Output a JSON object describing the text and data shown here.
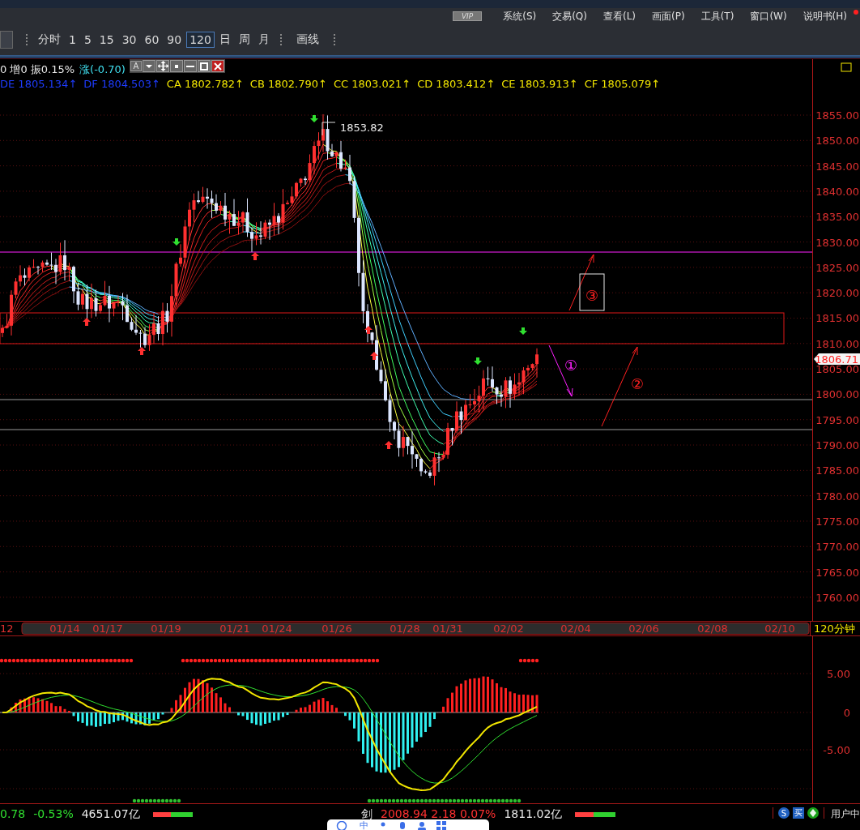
{
  "menu_bar": {
    "badge": "VIP",
    "items": [
      "系统(S)",
      "交易(Q)",
      "查看(L)",
      "画面(P)",
      "工具(T)",
      "窗口(W)",
      "说明书(H)"
    ]
  },
  "toolbar": {
    "periods": [
      {
        "label": "分时",
        "selected": false
      },
      {
        "label": "1",
        "selected": false
      },
      {
        "label": "5",
        "selected": false
      },
      {
        "label": "15",
        "selected": false
      },
      {
        "label": "30",
        "selected": false
      },
      {
        "label": "60",
        "selected": false
      },
      {
        "label": "90",
        "selected": false
      },
      {
        "label": "120",
        "selected": true
      },
      {
        "label": "日",
        "selected": false
      },
      {
        "label": "周",
        "selected": false
      },
      {
        "label": "月",
        "selected": false
      }
    ],
    "draw_label": "画线"
  },
  "quote_line": {
    "stats": "0 增0 振0.15%",
    "change": "涨(-0.70)"
  },
  "floating_toolbar": {
    "font_button": "A"
  },
  "indicator_values": [
    {
      "label": "DE 1805.134↑",
      "color": "#1e3cff"
    },
    {
      "label": "DF 1804.503↑",
      "color": "#1e3cff"
    },
    {
      "label": "CA 1802.782↑",
      "color": "#f2e600"
    },
    {
      "label": "CB 1802.790↑",
      "color": "#f2e600"
    },
    {
      "label": "CC 1803.021↑",
      "color": "#f2e600"
    },
    {
      "label": "CD 1803.412↑",
      "color": "#f2e600"
    },
    {
      "label": "CE 1803.913↑",
      "color": "#f2e600"
    },
    {
      "label": "CF 1805.079↑",
      "color": "#f2e600"
    }
  ],
  "price_axis": {
    "ticks": [
      "1855.00",
      "1850.00",
      "1845.00",
      "1840.00",
      "1835.00",
      "1830.00",
      "1825.00",
      "1820.00",
      "1815.00",
      "1810.00",
      "1805.00",
      "1800.00",
      "1795.00",
      "1790.00",
      "1785.00",
      "1780.00",
      "1775.00",
      "1770.00",
      "1765.00",
      "1760.00"
    ],
    "current_price": "1806.71"
  },
  "high_label": "1853.82",
  "annotations": [
    {
      "label": "①",
      "color": "#ff20ff"
    },
    {
      "label": "②",
      "color": "#ff2020"
    },
    {
      "label": "③",
      "color": "#ff2020"
    }
  ],
  "date_axis": {
    "left_label": "12",
    "dates": [
      "01/14",
      "01/17",
      "01/19",
      "01/21",
      "01/24",
      "01/26",
      "01/28",
      "01/31",
      "02/02",
      "02/04",
      "02/06",
      "02/08",
      "02/10"
    ],
    "period": "120分钟"
  },
  "macd_axis": {
    "ticks": [
      "5.00",
      "0",
      "-5.00"
    ]
  },
  "status_bar": {
    "left": [
      {
        "text": "0.78",
        "color": "#30e030"
      },
      {
        "text": "-0.53%",
        "color": "#30e030"
      },
      {
        "text": "4651.07亿",
        "color": "#e8e8e8"
      }
    ],
    "middle": [
      {
        "text": "剑",
        "color": "#e8e8e8"
      },
      {
        "text": "2008.94 2.18 0.07%",
        "color": "#ff3030"
      },
      {
        "text": "1811.02亿",
        "color": "#e8e8e8"
      }
    ],
    "ratio_bars": [
      {
        "level": 0.45
      },
      {
        "level": 0.45
      }
    ],
    "tray": {
      "s_label": "S",
      "buy_label": "买"
    },
    "user_label": "用户中"
  },
  "ime_bar": {
    "label": "中"
  }
}
